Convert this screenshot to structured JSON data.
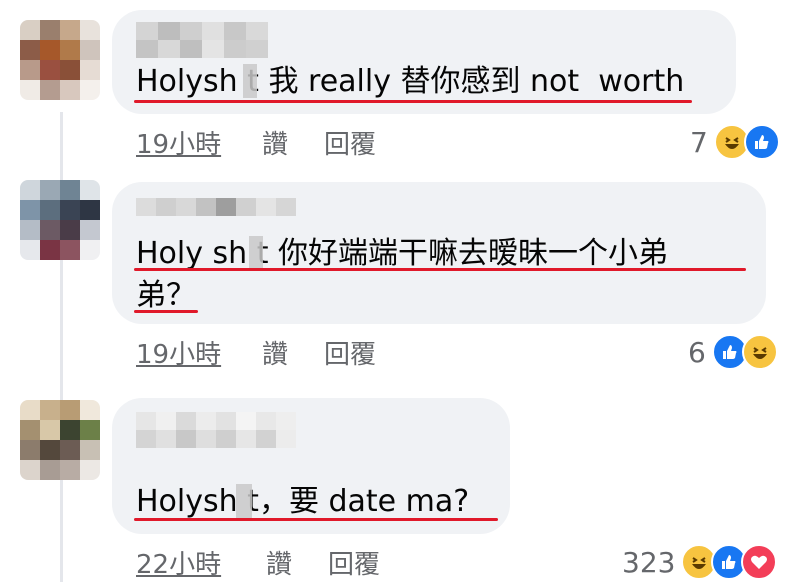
{
  "comments": [
    {
      "text": "Holysh t 我 really 替你感到 not  worth",
      "time": "19小時",
      "like": "讚",
      "reply": "回覆",
      "reaction_count": "7",
      "reactions": [
        "haha",
        "like"
      ]
    },
    {
      "text_line1": "Holy sh t 你好端端干嘛去暧昧一个小弟",
      "text_line2": "弟？",
      "time": "19小時",
      "like": "讚",
      "reply": "回覆",
      "reaction_count": "6",
      "reactions": [
        "like",
        "haha"
      ]
    },
    {
      "text": "Holysh t，要 date ma?",
      "time": "22小時",
      "like": "讚",
      "reply": "回覆",
      "reaction_count": "323",
      "reactions": [
        "haha",
        "like",
        "love"
      ]
    }
  ],
  "colors": {
    "bubble": "#f0f2f5",
    "underline": "#e0192a",
    "meta_text": "#65676b",
    "like_blue": "#1877f2",
    "haha_yellow": "#f7c440",
    "love_red": "#f33e58"
  },
  "icons": [
    "haha-icon",
    "like-icon",
    "love-icon"
  ]
}
